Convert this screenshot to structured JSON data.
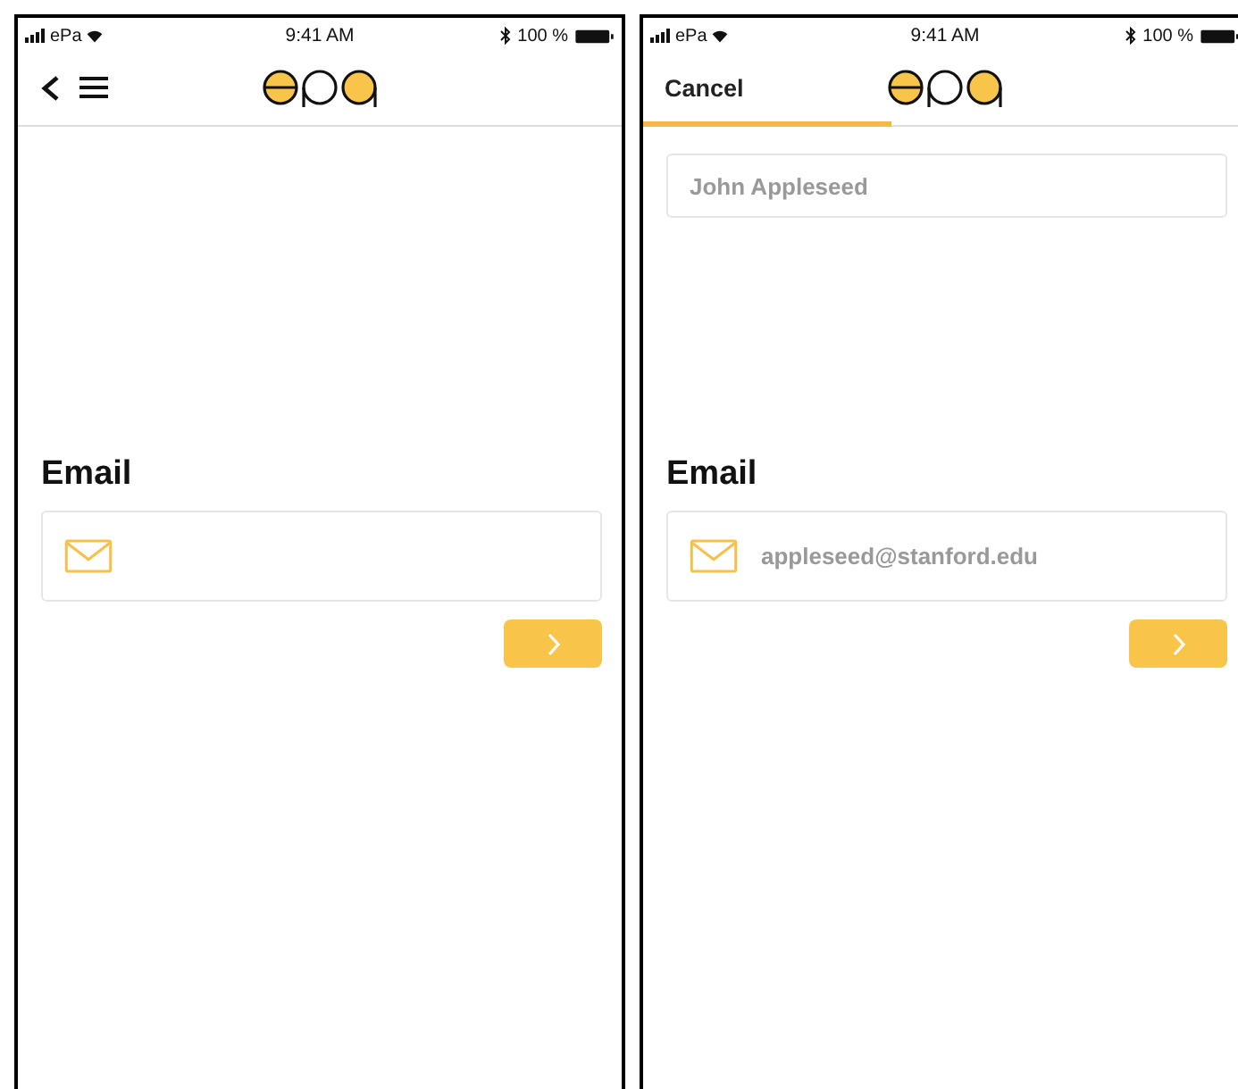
{
  "screens": [
    {
      "status_bar": {
        "carrier": "ePa",
        "time": "9:41 AM",
        "battery": "100 %"
      },
      "nav": {
        "kind": "menu"
      },
      "email": {
        "label": "Email"
      }
    },
    {
      "status_bar": {
        "carrier": "ePa",
        "time": "9:41 AM",
        "battery": "100 %"
      },
      "nav": {
        "kind": "cancel",
        "label": "Cancel"
      },
      "progress": {
        "level": 0.41
      },
      "name_field": {
        "value": "John Appleseed"
      },
      "email": {
        "label": "Email",
        "value": "appleseed@stanford.edu"
      }
    }
  ]
}
